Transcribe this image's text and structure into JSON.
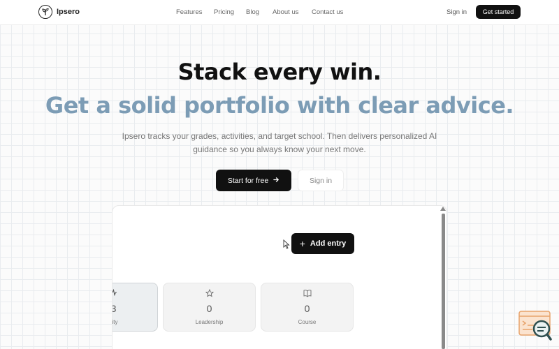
{
  "nav": {
    "brand": "Ipsero",
    "links": [
      "Features",
      "Pricing",
      "Blog",
      "About us",
      "Contact us"
    ],
    "signin": "Sign in",
    "cta": "Get started"
  },
  "hero": {
    "title": "Stack every win.",
    "subtitle": "Get a solid portfolio with clear advice.",
    "description": "Ipsero tracks your grades, activities, and target school. Then delivers personalized AI guidance so you always know your next move.",
    "primary_button": "Start for free",
    "secondary_button": "Sign in"
  },
  "preview": {
    "add_entry": "Add entry",
    "cards": [
      {
        "value": "3",
        "label": "vity",
        "icon": "activity-icon"
      },
      {
        "value": "0",
        "label": "Leadership",
        "icon": "star-icon"
      },
      {
        "value": "0",
        "label": "Course",
        "icon": "book-icon"
      }
    ]
  },
  "colors": {
    "accent": "#7c9cb5",
    "dark": "#111111",
    "widget": "#e8a36b"
  }
}
